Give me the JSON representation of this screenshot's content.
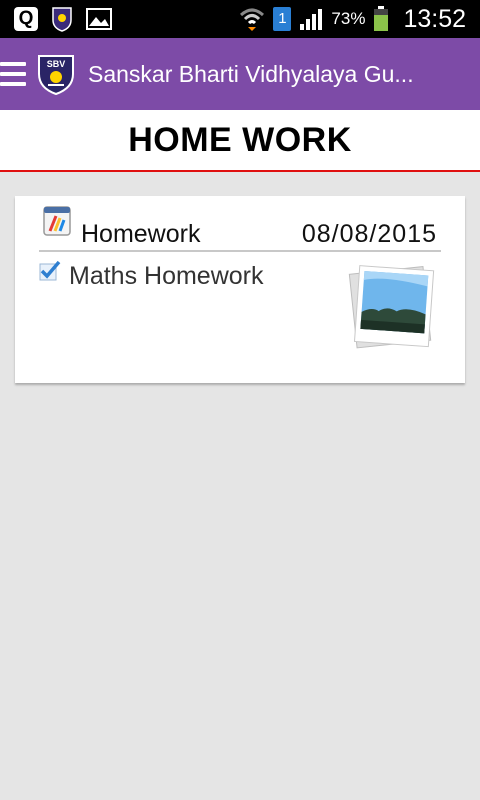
{
  "status_bar": {
    "battery": "73%",
    "time": "13:52",
    "sim_slot": "1",
    "icons": [
      "q-app-icon",
      "school-badge-icon",
      "gallery-icon",
      "wifi-icon",
      "signal-icon",
      "battery-icon"
    ]
  },
  "appbar": {
    "title": "Sanskar Bharti Vidhyalaya Gu...",
    "logo_text": "SBV",
    "menu_icon": "hamburger-icon"
  },
  "page": {
    "heading": "HOME WORK"
  },
  "homework_card": {
    "title": "Homework",
    "date": "08/08/2015",
    "item": {
      "label": "Maths Homework",
      "checked": true
    }
  },
  "colors": {
    "appbar": "#7d4ba7",
    "divider": "#e01010",
    "background": "#e5e5e5"
  }
}
